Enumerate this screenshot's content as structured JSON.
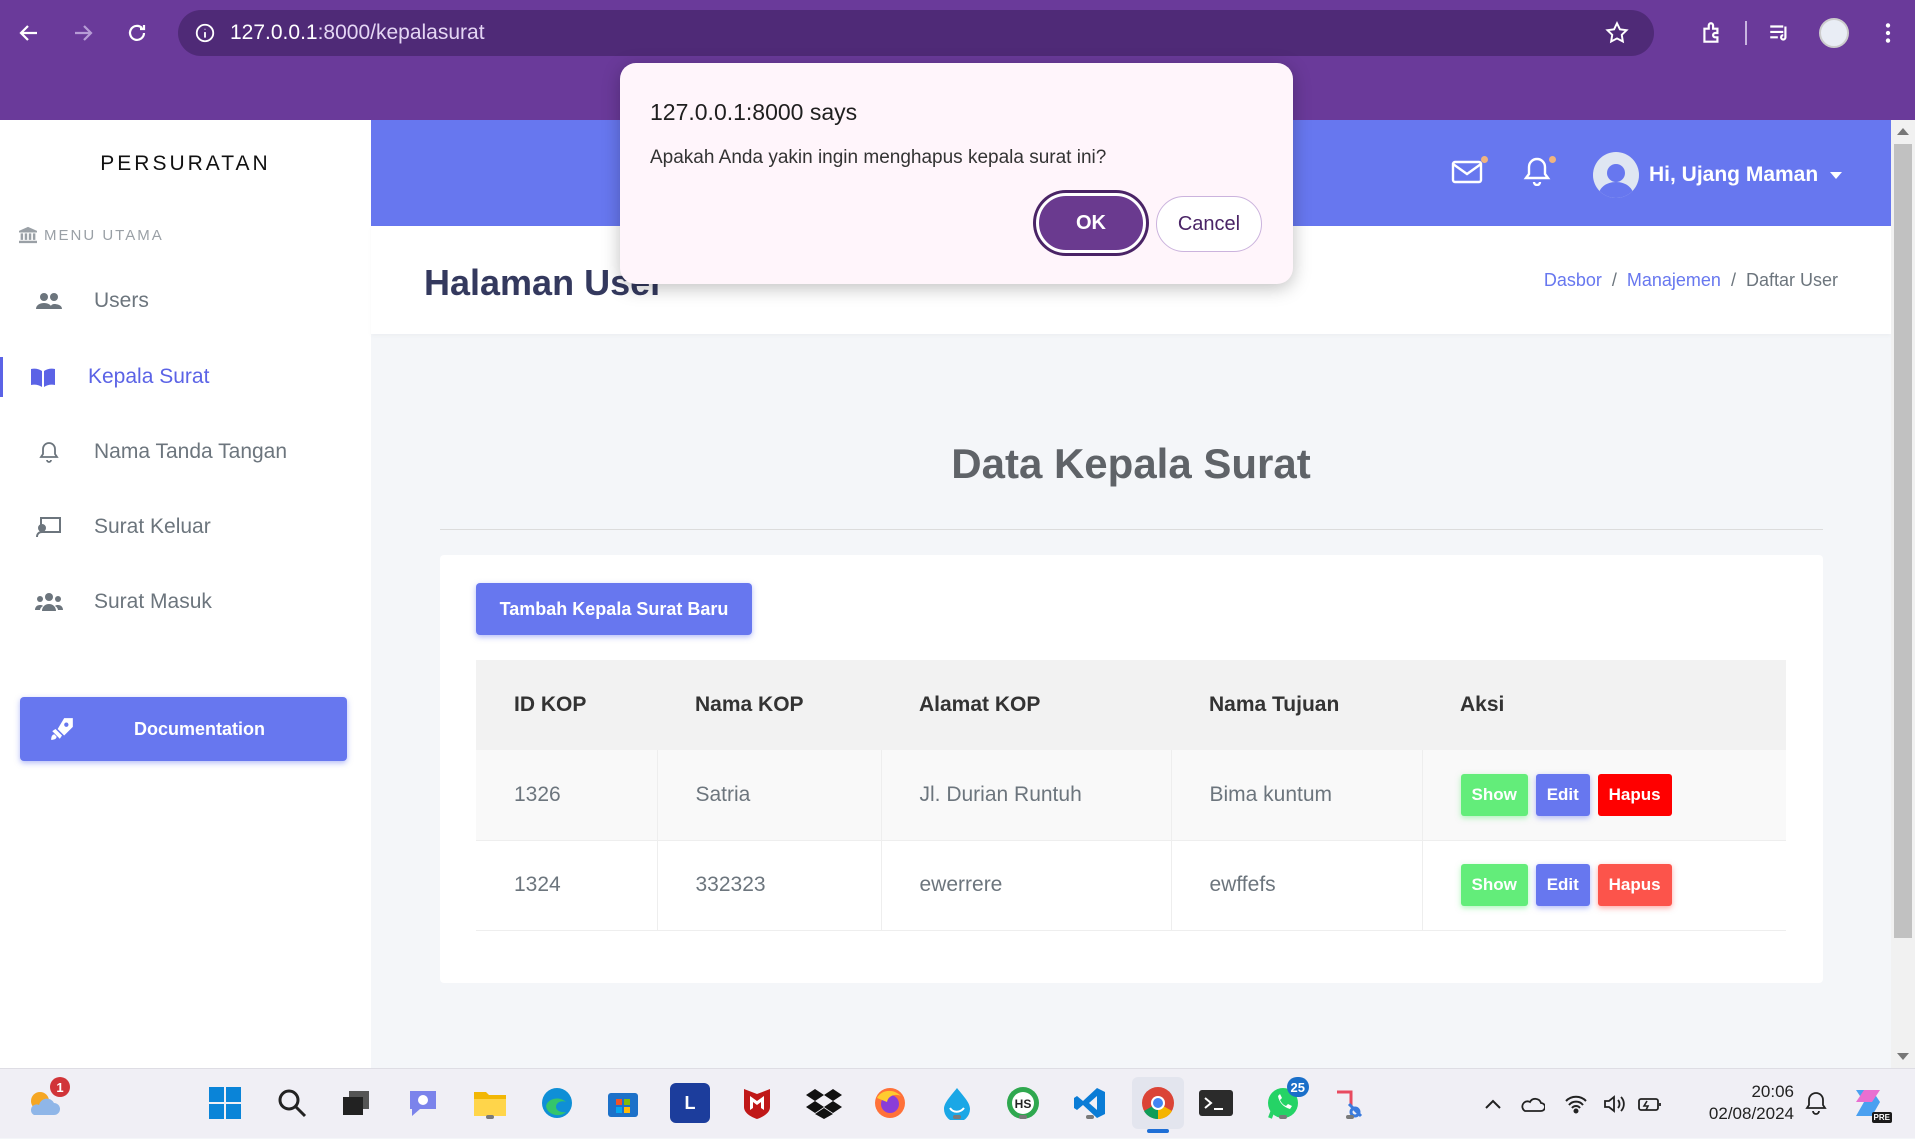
{
  "browser": {
    "url_host": "127.0.0.1",
    "url_path": ":8000/kepalasurat"
  },
  "sidebar": {
    "brand": "PERSURATAN",
    "menu_header": "MENU UTAMA",
    "items": [
      {
        "label": "Users",
        "icon": "users-icon"
      },
      {
        "label": "Kepala Surat",
        "icon": "book-icon",
        "active": true
      },
      {
        "label": "Nama Tanda Tangan",
        "icon": "bell-icon"
      },
      {
        "label": "Surat Keluar",
        "icon": "chalkboard-icon"
      },
      {
        "label": "Surat Masuk",
        "icon": "user-group-icon"
      }
    ],
    "documentation_label": "Documentation"
  },
  "topnav": {
    "user_greeting": "Hi, Ujang Maman"
  },
  "page": {
    "title": "Halaman User",
    "breadcrumb": [
      "Dasbor",
      "Manajemen",
      "Daftar User"
    ],
    "breadcrumb_sep": "/"
  },
  "content": {
    "section_title": "Data Kepala Surat",
    "add_button": "Tambah Kepala Surat Baru",
    "table": {
      "headers": [
        "ID KOP",
        "Nama KOP",
        "Alamat KOP",
        "Nama Tujuan",
        "Aksi"
      ],
      "rows": [
        {
          "id": "1326",
          "nama": "Satria",
          "alamat": "Jl. Durian Runtuh",
          "tujuan": "Bima kuntum"
        },
        {
          "id": "1324",
          "nama": "332323",
          "alamat": "ewerrere",
          "tujuan": "ewffefs"
        }
      ],
      "actions": {
        "show": "Show",
        "edit": "Edit",
        "delete": "Hapus"
      }
    }
  },
  "dialog": {
    "title": "127.0.0.1:8000 says",
    "message": "Apakah Anda yakin ingin menghapus kepala surat ini?",
    "ok": "OK",
    "cancel": "Cancel"
  },
  "taskbar": {
    "weather_badge": "1",
    "whatsapp_badge": "25",
    "time": "20:06",
    "date": "02/08/2024",
    "dev_badge": "PRE"
  },
  "colors": {
    "primary": "#6777ef",
    "success": "#63ed7a",
    "danger": "#fc544b",
    "chrome": "#6a3a9a"
  }
}
